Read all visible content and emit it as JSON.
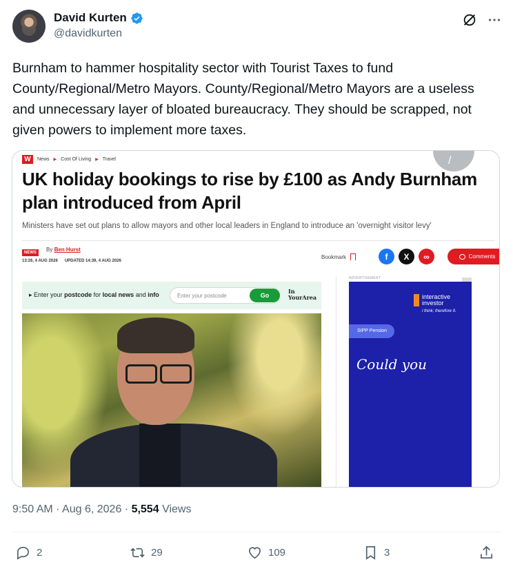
{
  "author": {
    "display_name": "David Kurten",
    "handle": "@davidkurten",
    "verified": true
  },
  "header_icons": [
    "grok-icon",
    "more-icon"
  ],
  "tweet": {
    "text": "Burnham to hammer hospitality sector with Tourist Taxes to fund County/Regional/Metro Mayors. County/Regional/Metro Mayors are a useless and unnecessary layer of bloated bureaucracy. They should be scrapped, not given powers to implement more taxes."
  },
  "card": {
    "logo": "W",
    "breadcrumbs": [
      "News",
      "Cost Of Living",
      "Travel"
    ],
    "headline": "UK holiday bookings to rise by £100 as Andy Burnham plan introduced from April",
    "subheadline": "Ministers have set out plans to allow mayors and other local leaders in England to introduce an 'overnight visitor levy'",
    "news_tag": "NEWS",
    "byline_prefix": "By",
    "author": "Ben Hurst",
    "published": "13:26, 4 AUG 2026",
    "updated": "UPDATED 14:39, 4 AUG 2026",
    "bookmark_label": "Bookmark",
    "comments_label": "Comments",
    "postcode": {
      "label_pre": "Enter your",
      "label_bold1": "postcode",
      "label_mid": "for",
      "label_bold2": "local news",
      "label_and": "and",
      "label_bold3": "info",
      "placeholder": "Enter your postcode",
      "button": "Go",
      "brand_line1": "In",
      "brand_line2": "YourArea"
    },
    "ad": {
      "label": "ADVERTISEMENT",
      "brand_line1": "interactive",
      "brand_line2": "investor",
      "tagline": "i think; therefore II.",
      "pill": "SIPP Pension",
      "headline": "Could you"
    }
  },
  "meta": {
    "time": "9:50 AM",
    "date": "Aug 6, 2026",
    "views_count": "5,554",
    "views_label": "Views"
  },
  "actions": {
    "replies": "2",
    "reposts": "29",
    "likes": "109",
    "bookmarks": "3"
  },
  "colors": {
    "verified": "#1d9bf0",
    "mirror_red": "#e01b22",
    "ad_blue": "#1d20a8",
    "muted_text": "#536471"
  }
}
